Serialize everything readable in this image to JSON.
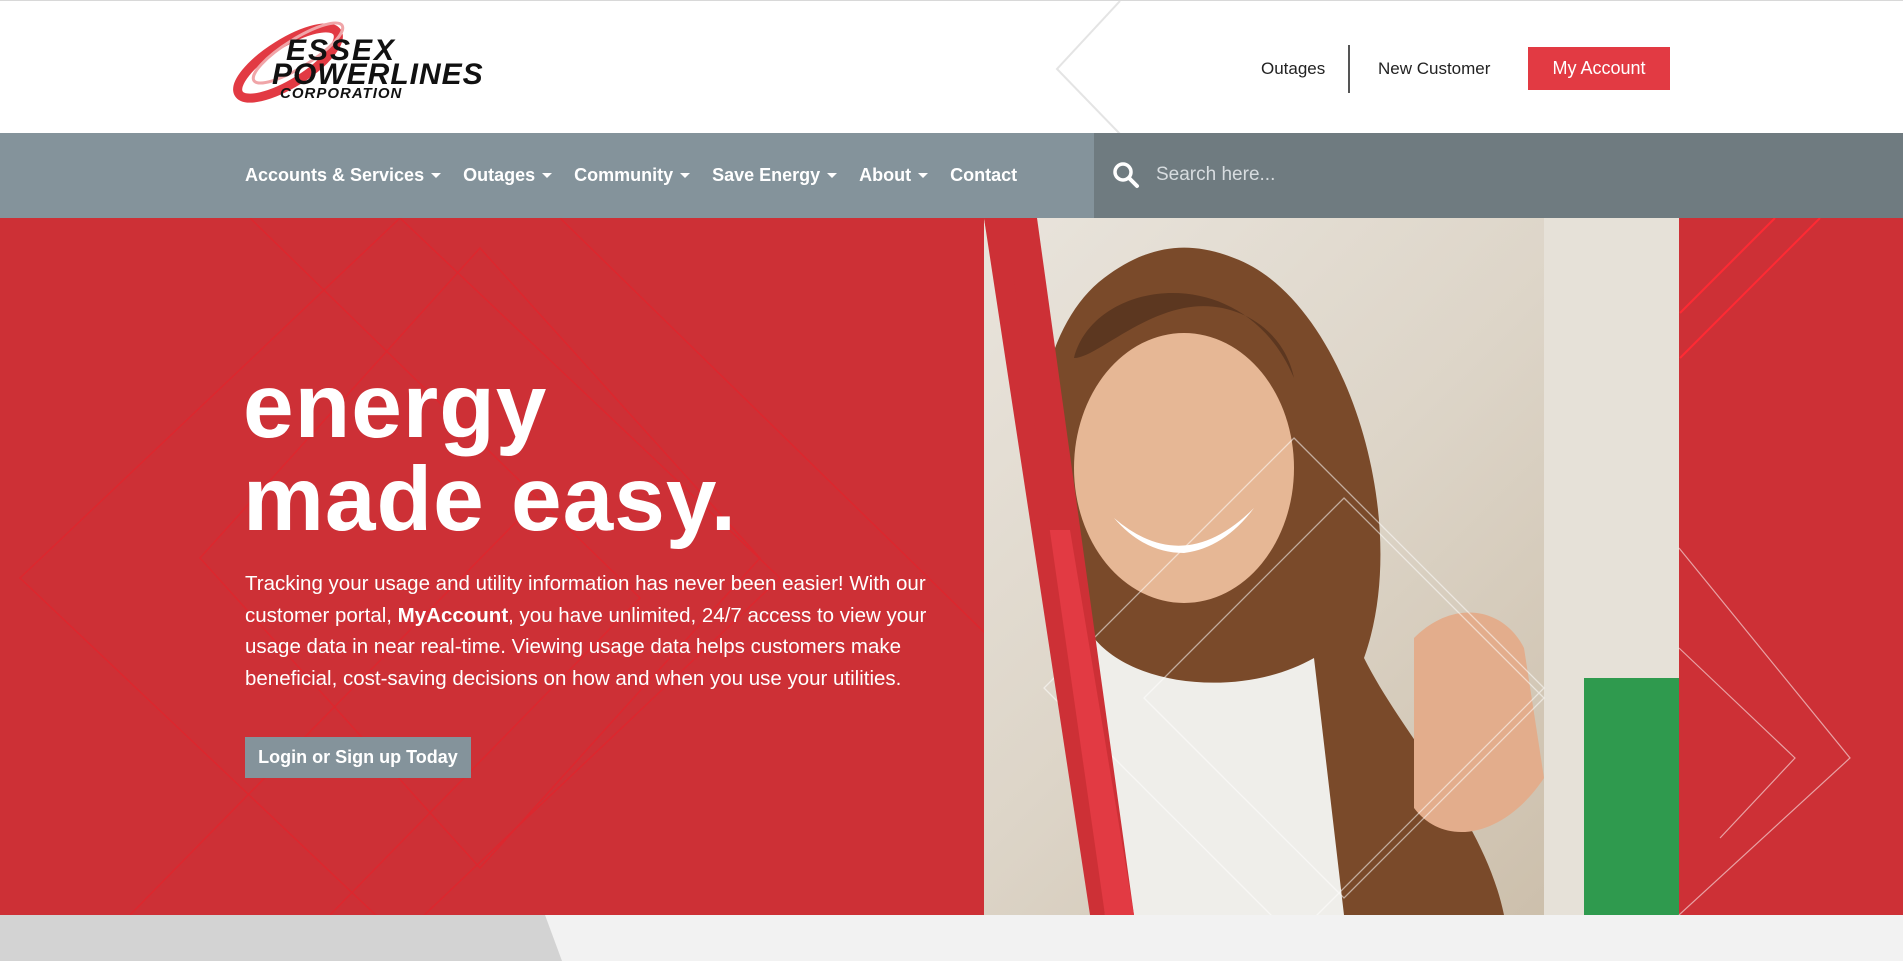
{
  "brand": {
    "name_line1": "ESSEX",
    "name_line2": "POWERLINES",
    "name_line3": "CORPORATION",
    "accent": "#e23a43",
    "hero_red": "#cd3036",
    "nav_gray": "#84939b",
    "search_gray": "#6f7b80"
  },
  "utility_nav": {
    "outages": "Outages",
    "new_customer": "New Customer",
    "my_account": "My Account"
  },
  "main_nav": {
    "items": [
      {
        "label": "Accounts & Services",
        "dropdown": true
      },
      {
        "label": "Outages",
        "dropdown": true
      },
      {
        "label": "Community",
        "dropdown": true
      },
      {
        "label": "Save Energy",
        "dropdown": true
      },
      {
        "label": "About",
        "dropdown": true
      },
      {
        "label": "Contact",
        "dropdown": false
      }
    ]
  },
  "search": {
    "placeholder": "Search here...",
    "icon": "search-icon"
  },
  "hero": {
    "title_line1": "energy",
    "title_line2": "made easy.",
    "text_before": "Tracking your usage and utility information has never been easier! With our customer portal, ",
    "text_bold": "MyAccount",
    "text_after": ", you have unlimited, 24/7 access to view your usage data in near real-time. Viewing usage data helps customers make beneficial, cost-saving decisions on how and when you use your utilities.",
    "cta": "Login or Sign up Today",
    "image": "smiling-woman-waving-photo"
  }
}
